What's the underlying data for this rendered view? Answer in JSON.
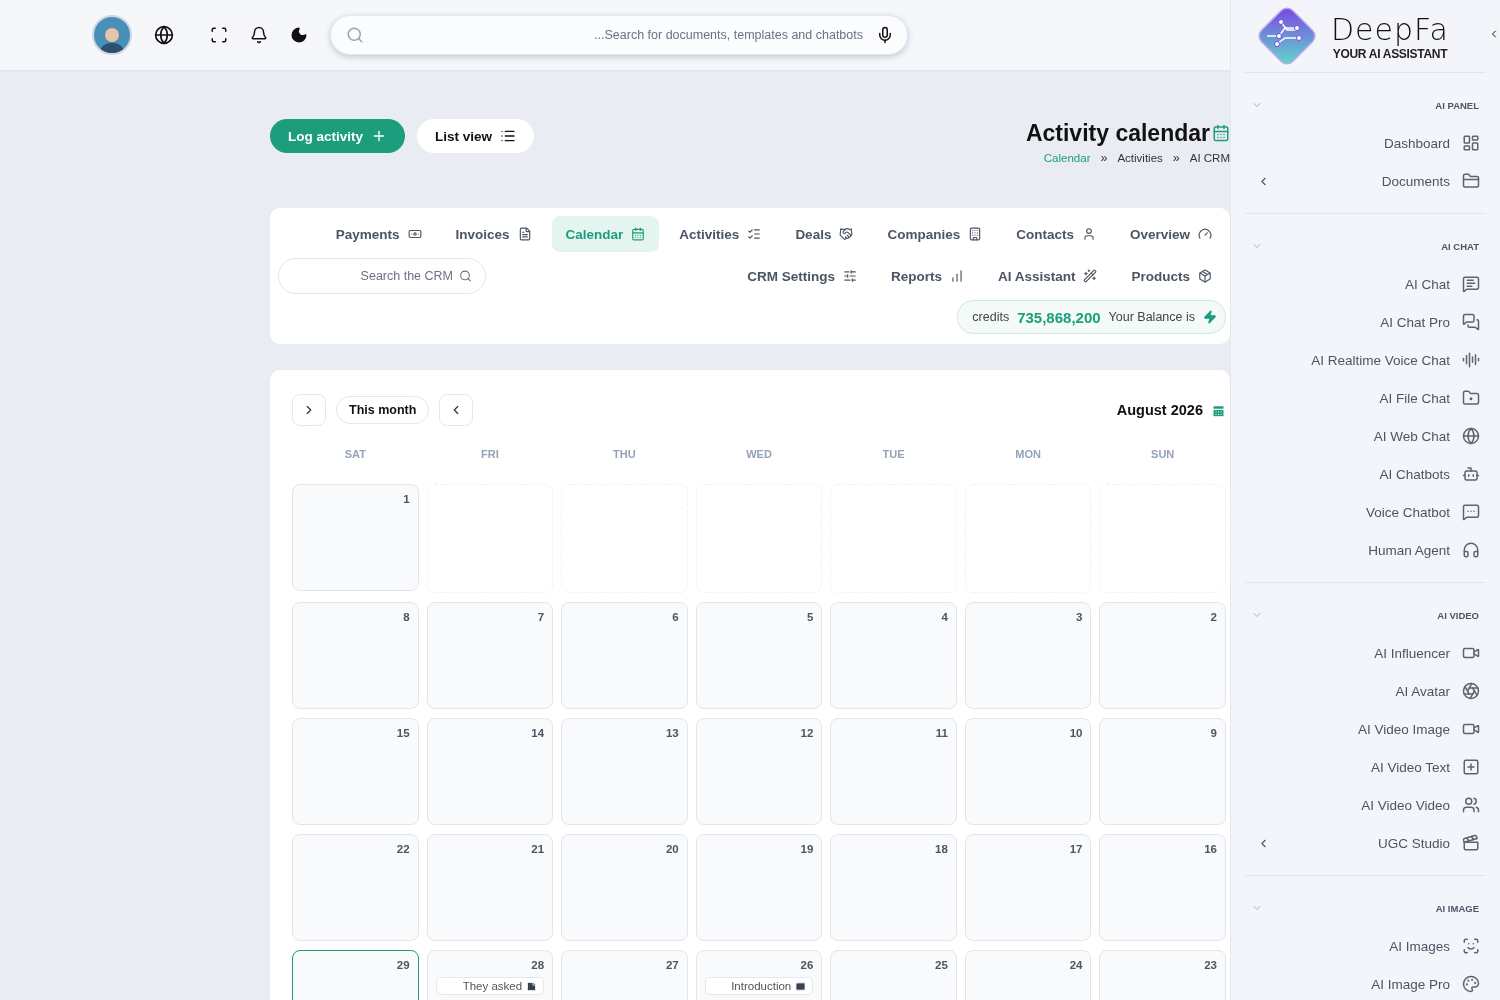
{
  "topbar": {
    "search": {
      "placeholder": "...Search for documents, templates and chatbots"
    }
  },
  "header": {
    "title": "Activity calendar",
    "buttons": [
      {
        "label": "Log activity",
        "kind": "primary"
      },
      {
        "label": "List view",
        "kind": "secondary"
      }
    ],
    "breadcrumb": [
      {
        "label": "Calendar",
        "kind": "crumb",
        "selected": true
      },
      {
        "label": "»",
        "kind": "separator",
        "selected": false
      },
      {
        "label": "Activities",
        "kind": "crumb",
        "selected": false
      },
      {
        "label": "»",
        "kind": "separator",
        "selected": false
      },
      {
        "label": "AI CRM",
        "kind": "crumb",
        "selected": false
      }
    ]
  },
  "crm": {
    "tabs": [
      {
        "label": "Payments",
        "selected": false
      },
      {
        "label": "Invoices",
        "selected": false
      },
      {
        "label": "Calendar",
        "selected": true
      },
      {
        "label": "Activities",
        "selected": false
      },
      {
        "label": "Deals",
        "selected": false
      },
      {
        "label": "Companies",
        "selected": false
      },
      {
        "label": "Contacts",
        "selected": false
      },
      {
        "label": "Overview",
        "selected": false
      }
    ],
    "search": {
      "placeholder": "Search the CRM"
    },
    "tabs_row_2": [
      {
        "label": "CRM Settings",
        "selected": false
      },
      {
        "label": "Reports",
        "selected": false
      },
      {
        "label": "AI Assistant",
        "selected": false
      },
      {
        "label": "Products",
        "selected": false
      }
    ],
    "credits": {
      "unit": "credits",
      "amount": "735,868,200",
      "caption": "Your Balance is"
    }
  },
  "calendar": {
    "today_button": "This month",
    "title": "August 2026",
    "weekdays": [
      "SAT",
      "FRI",
      "THU",
      "WED",
      "TUE",
      "MON",
      "SUN"
    ],
    "weeks": [
      [
        {
          "kind": "day",
          "day": "1",
          "today": false
        },
        {
          "kind": "blank"
        },
        {
          "kind": "blank"
        },
        {
          "kind": "blank"
        },
        {
          "kind": "blank"
        },
        {
          "kind": "blank"
        },
        {
          "kind": "blank"
        }
      ],
      [
        {
          "kind": "day",
          "day": "8",
          "today": false
        },
        {
          "kind": "day",
          "day": "7",
          "today": false
        },
        {
          "kind": "day",
          "day": "6",
          "today": false
        },
        {
          "kind": "day",
          "day": "5",
          "today": false
        },
        {
          "kind": "day",
          "day": "4",
          "today": false
        },
        {
          "kind": "day",
          "day": "3",
          "today": false
        },
        {
          "kind": "day",
          "day": "2",
          "today": false
        }
      ],
      [
        {
          "kind": "day",
          "day": "15",
          "today": false
        },
        {
          "kind": "day",
          "day": "14",
          "today": false
        },
        {
          "kind": "day",
          "day": "13",
          "today": false
        },
        {
          "kind": "day",
          "day": "12",
          "today": false
        },
        {
          "kind": "day",
          "day": "11",
          "today": false
        },
        {
          "kind": "day",
          "day": "10",
          "today": false
        },
        {
          "kind": "day",
          "day": "9",
          "today": false
        }
      ],
      [
        {
          "kind": "day",
          "day": "22",
          "today": false
        },
        {
          "kind": "day",
          "day": "21",
          "today": false
        },
        {
          "kind": "day",
          "day": "20",
          "today": false
        },
        {
          "kind": "day",
          "day": "19",
          "today": false
        },
        {
          "kind": "day",
          "day": "18",
          "today": false
        },
        {
          "kind": "day",
          "day": "17",
          "today": false
        },
        {
          "kind": "day",
          "day": "16",
          "today": false
        }
      ],
      [
        {
          "kind": "day",
          "day": "29",
          "today": true
        },
        {
          "kind": "day",
          "day": "28",
          "today": false,
          "events": [
            {
              "title": "They asked",
              "kind": "note"
            }
          ]
        },
        {
          "kind": "day",
          "day": "27",
          "today": false
        },
        {
          "kind": "day",
          "day": "26",
          "today": false,
          "events": [
            {
              "title": "Introduction",
              "kind": "email"
            }
          ]
        },
        {
          "kind": "day",
          "day": "25",
          "today": false
        },
        {
          "kind": "day",
          "day": "24",
          "today": false
        },
        {
          "kind": "day",
          "day": "23",
          "today": false
        }
      ]
    ]
  },
  "sidebar": {
    "brand": {
      "name": "DeepFa",
      "tagline": "YOUR AI ASSISTANT"
    },
    "sections": [
      {
        "title": "AI PANEL",
        "expanded": true,
        "items": [
          {
            "label": "Dashboard",
            "has_submenu": false
          },
          {
            "label": "Documents",
            "has_submenu": true
          }
        ]
      },
      {
        "title": "AI CHAT",
        "expanded": true,
        "items": [
          {
            "label": "AI Chat",
            "has_submenu": false
          },
          {
            "label": "AI Chat Pro",
            "has_submenu": false
          },
          {
            "label": "AI Realtime Voice Chat",
            "has_submenu": false
          },
          {
            "label": "AI File Chat",
            "has_submenu": false
          },
          {
            "label": "AI Web Chat",
            "has_submenu": false
          },
          {
            "label": "AI Chatbots",
            "has_submenu": false
          },
          {
            "label": "Voice Chatbot",
            "has_submenu": false
          },
          {
            "label": "Human Agent",
            "has_submenu": false
          }
        ]
      },
      {
        "title": "AI VIDEO",
        "expanded": true,
        "items": [
          {
            "label": "AI Influencer",
            "has_submenu": false
          },
          {
            "label": "AI Avatar",
            "has_submenu": false
          },
          {
            "label": "AI Video Image",
            "has_submenu": false
          },
          {
            "label": "AI Video Text",
            "has_submenu": false
          },
          {
            "label": "AI Video Video",
            "has_submenu": false
          },
          {
            "label": "UGC Studio",
            "has_submenu": true
          }
        ]
      },
      {
        "title": "AI IMAGE",
        "expanded": true,
        "items": [
          {
            "label": "AI Images",
            "has_submenu": false
          },
          {
            "label": "AI Image Pro",
            "has_submenu": false
          }
        ]
      }
    ]
  }
}
